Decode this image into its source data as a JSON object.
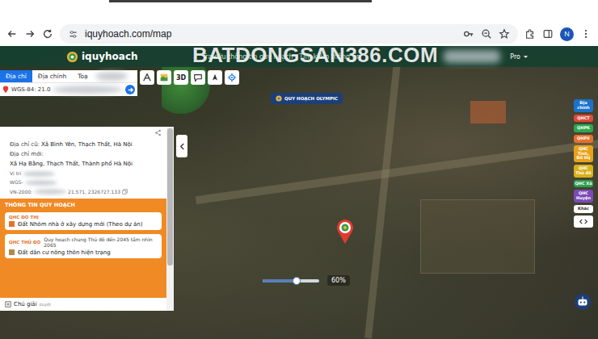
{
  "browser": {
    "url": "iquyhoach.com/map",
    "avatar": "N"
  },
  "watermark": "BATDONGSAN386.COM",
  "header": {
    "logo": "iquyhoach",
    "tagline": "Tra cứu thông tin quy hoạch · Tìm kiếm thông tin",
    "plan": "Pro"
  },
  "search_panel": {
    "tabs": [
      {
        "label": "Địa chỉ",
        "selected": true
      },
      {
        "label": "Địa chính",
        "selected": false
      },
      {
        "label": "Toạ",
        "selected": false
      }
    ],
    "query": "WGS-84: 21.0"
  },
  "tools": [
    {
      "kind": "measure",
      "label": ""
    },
    {
      "kind": "layers",
      "label": ""
    },
    {
      "kind": "text",
      "label": "3D"
    },
    {
      "kind": "chat",
      "label": ""
    },
    {
      "kind": "north",
      "label": ""
    },
    {
      "kind": "locate",
      "label": ""
    }
  ],
  "map_label": "QUY HOẠCH OLYMPIC",
  "info": {
    "lines": [
      {
        "label": "Địa chỉ cũ:",
        "value": "Xã Bình Yên, Thạch Thất, Hà Nội"
      },
      {
        "label": "Địa chỉ mới:",
        "value": "Xã Hạ Bằng, Thạch Thất, Thành phố Hà Nội"
      }
    ],
    "position": "Vị trí",
    "wgs": "WGS-",
    "vn2000_label": "VN-2000:",
    "vn2000_value": "21.571, 2326727.133"
  },
  "planning": {
    "title": "THÔNG TIN QUY HOẠCH",
    "items": [
      {
        "tag": "QHC ĐÔ THỊ",
        "subtitle": "",
        "value": "Đất Nhóm nhà ở xây dựng mới (Theo dự án)",
        "color": "#e8702a"
      },
      {
        "tag": "QHC THỦ ĐÔ",
        "subtitle": "Quy hoạch chung Thủ đô đến 2045 tầm nhìn 2065",
        "value": "Đất dân cư nông thôn hiện trạng",
        "color": "#b5884a"
      }
    ]
  },
  "legend": {
    "label": "Chú giải",
    "note": "duyệt"
  },
  "layers": [
    {
      "label": "Địa chính",
      "color": "#1a73c9"
    },
    {
      "label": "QHCT",
      "color": "#e04a3a"
    },
    {
      "label": "QHPK",
      "color": "#2ea84f"
    },
    {
      "label": "QHPX",
      "color": "#e8702a"
    },
    {
      "label": "QHC Tỉnh, Đô thị",
      "color": "#e8a21a"
    },
    {
      "label": "QHC Thủ đô",
      "color": "#d9b019"
    },
    {
      "label": "QHC Xã",
      "color": "#2e9e4f"
    },
    {
      "label": "QHC Huyện",
      "color": "#7a4bb5"
    },
    {
      "label": "Khác",
      "color": "#ffffff"
    }
  ],
  "opacity": {
    "level": 0.6,
    "reading": "60%"
  }
}
